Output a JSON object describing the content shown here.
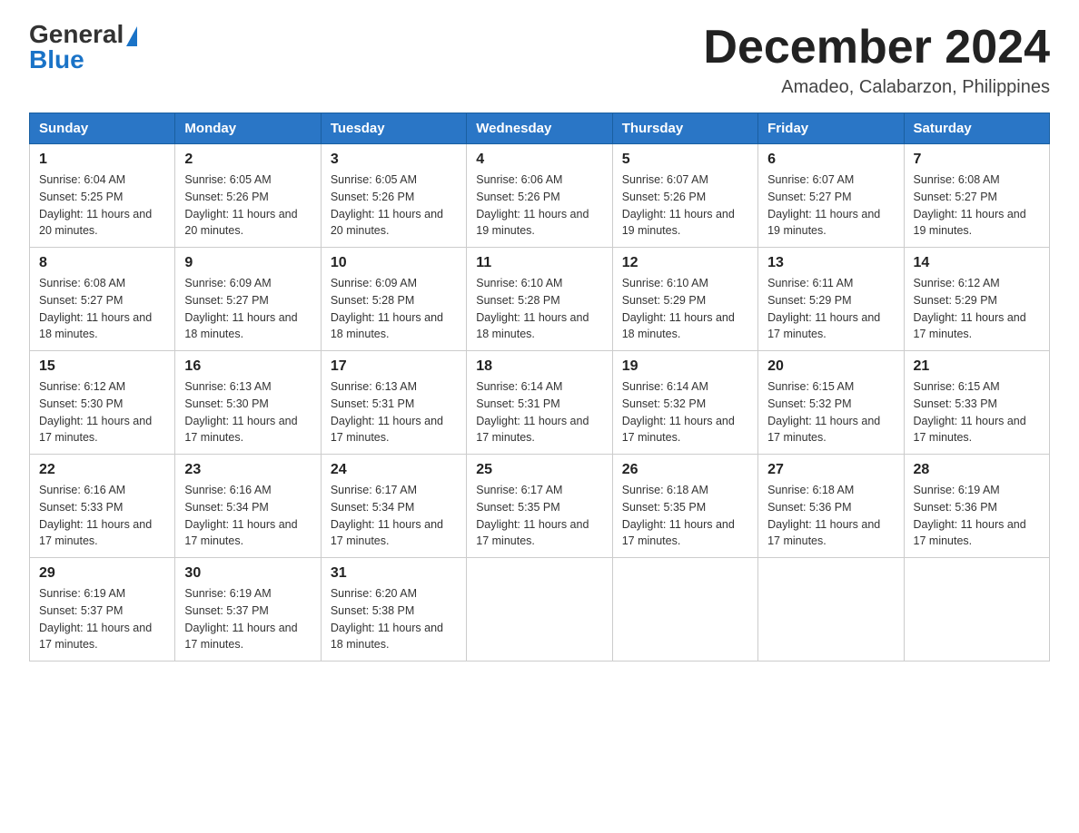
{
  "logo": {
    "general": "General",
    "blue": "Blue"
  },
  "header": {
    "month_year": "December 2024",
    "location": "Amadeo, Calabarzon, Philippines"
  },
  "days_of_week": [
    "Sunday",
    "Monday",
    "Tuesday",
    "Wednesday",
    "Thursday",
    "Friday",
    "Saturday"
  ],
  "weeks": [
    [
      {
        "day": "1",
        "sunrise": "6:04 AM",
        "sunset": "5:25 PM",
        "daylight": "11 hours and 20 minutes."
      },
      {
        "day": "2",
        "sunrise": "6:05 AM",
        "sunset": "5:26 PM",
        "daylight": "11 hours and 20 minutes."
      },
      {
        "day": "3",
        "sunrise": "6:05 AM",
        "sunset": "5:26 PM",
        "daylight": "11 hours and 20 minutes."
      },
      {
        "day": "4",
        "sunrise": "6:06 AM",
        "sunset": "5:26 PM",
        "daylight": "11 hours and 19 minutes."
      },
      {
        "day": "5",
        "sunrise": "6:07 AM",
        "sunset": "5:26 PM",
        "daylight": "11 hours and 19 minutes."
      },
      {
        "day": "6",
        "sunrise": "6:07 AM",
        "sunset": "5:27 PM",
        "daylight": "11 hours and 19 minutes."
      },
      {
        "day": "7",
        "sunrise": "6:08 AM",
        "sunset": "5:27 PM",
        "daylight": "11 hours and 19 minutes."
      }
    ],
    [
      {
        "day": "8",
        "sunrise": "6:08 AM",
        "sunset": "5:27 PM",
        "daylight": "11 hours and 18 minutes."
      },
      {
        "day": "9",
        "sunrise": "6:09 AM",
        "sunset": "5:27 PM",
        "daylight": "11 hours and 18 minutes."
      },
      {
        "day": "10",
        "sunrise": "6:09 AM",
        "sunset": "5:28 PM",
        "daylight": "11 hours and 18 minutes."
      },
      {
        "day": "11",
        "sunrise": "6:10 AM",
        "sunset": "5:28 PM",
        "daylight": "11 hours and 18 minutes."
      },
      {
        "day": "12",
        "sunrise": "6:10 AM",
        "sunset": "5:29 PM",
        "daylight": "11 hours and 18 minutes."
      },
      {
        "day": "13",
        "sunrise": "6:11 AM",
        "sunset": "5:29 PM",
        "daylight": "11 hours and 17 minutes."
      },
      {
        "day": "14",
        "sunrise": "6:12 AM",
        "sunset": "5:29 PM",
        "daylight": "11 hours and 17 minutes."
      }
    ],
    [
      {
        "day": "15",
        "sunrise": "6:12 AM",
        "sunset": "5:30 PM",
        "daylight": "11 hours and 17 minutes."
      },
      {
        "day": "16",
        "sunrise": "6:13 AM",
        "sunset": "5:30 PM",
        "daylight": "11 hours and 17 minutes."
      },
      {
        "day": "17",
        "sunrise": "6:13 AM",
        "sunset": "5:31 PM",
        "daylight": "11 hours and 17 minutes."
      },
      {
        "day": "18",
        "sunrise": "6:14 AM",
        "sunset": "5:31 PM",
        "daylight": "11 hours and 17 minutes."
      },
      {
        "day": "19",
        "sunrise": "6:14 AM",
        "sunset": "5:32 PM",
        "daylight": "11 hours and 17 minutes."
      },
      {
        "day": "20",
        "sunrise": "6:15 AM",
        "sunset": "5:32 PM",
        "daylight": "11 hours and 17 minutes."
      },
      {
        "day": "21",
        "sunrise": "6:15 AM",
        "sunset": "5:33 PM",
        "daylight": "11 hours and 17 minutes."
      }
    ],
    [
      {
        "day": "22",
        "sunrise": "6:16 AM",
        "sunset": "5:33 PM",
        "daylight": "11 hours and 17 minutes."
      },
      {
        "day": "23",
        "sunrise": "6:16 AM",
        "sunset": "5:34 PM",
        "daylight": "11 hours and 17 minutes."
      },
      {
        "day": "24",
        "sunrise": "6:17 AM",
        "sunset": "5:34 PM",
        "daylight": "11 hours and 17 minutes."
      },
      {
        "day": "25",
        "sunrise": "6:17 AM",
        "sunset": "5:35 PM",
        "daylight": "11 hours and 17 minutes."
      },
      {
        "day": "26",
        "sunrise": "6:18 AM",
        "sunset": "5:35 PM",
        "daylight": "11 hours and 17 minutes."
      },
      {
        "day": "27",
        "sunrise": "6:18 AM",
        "sunset": "5:36 PM",
        "daylight": "11 hours and 17 minutes."
      },
      {
        "day": "28",
        "sunrise": "6:19 AM",
        "sunset": "5:36 PM",
        "daylight": "11 hours and 17 minutes."
      }
    ],
    [
      {
        "day": "29",
        "sunrise": "6:19 AM",
        "sunset": "5:37 PM",
        "daylight": "11 hours and 17 minutes."
      },
      {
        "day": "30",
        "sunrise": "6:19 AM",
        "sunset": "5:37 PM",
        "daylight": "11 hours and 17 minutes."
      },
      {
        "day": "31",
        "sunrise": "6:20 AM",
        "sunset": "5:38 PM",
        "daylight": "11 hours and 18 minutes."
      },
      null,
      null,
      null,
      null
    ]
  ]
}
